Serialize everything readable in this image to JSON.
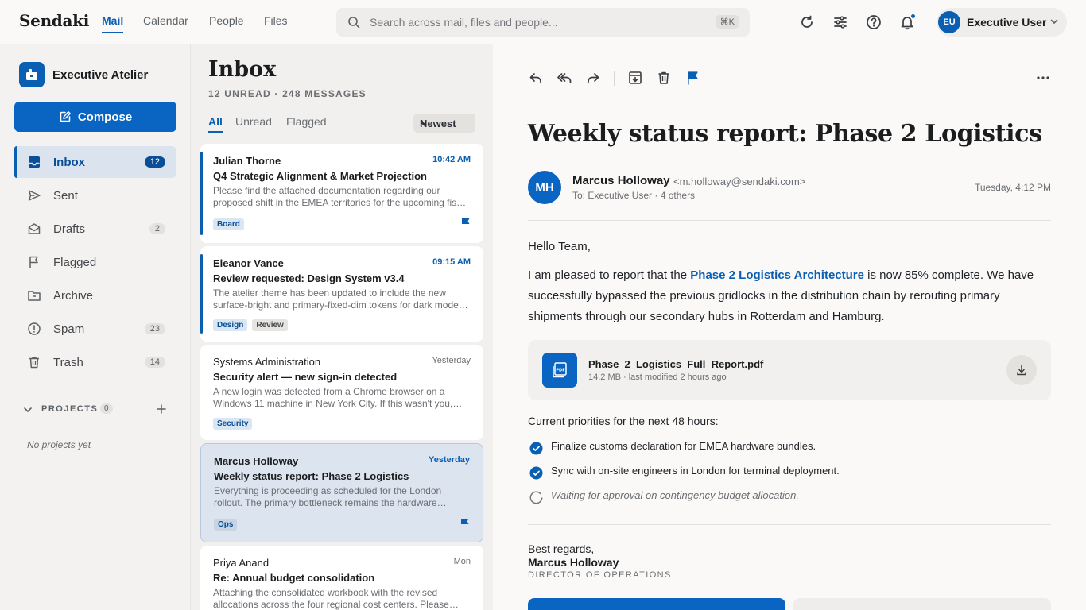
{
  "app": {
    "brand": "Sendaki"
  },
  "nav": {
    "tabs": [
      {
        "label": "Mail"
      },
      {
        "label": "Calendar"
      },
      {
        "label": "People"
      },
      {
        "label": "Files"
      }
    ]
  },
  "search": {
    "placeholder": "Search across mail, files and people...",
    "shortcut": "⌘K"
  },
  "user": {
    "initials": "EU",
    "name": "Executive User"
  },
  "sidebar": {
    "workspace": "Executive Atelier",
    "compose_label": "Compose",
    "items": [
      {
        "label": "Inbox",
        "count": "12"
      },
      {
        "label": "Sent",
        "count": ""
      },
      {
        "label": "Drafts",
        "count": "2"
      },
      {
        "label": "Flagged",
        "count": ""
      },
      {
        "label": "Archive",
        "count": ""
      },
      {
        "label": "Spam",
        "count": "23"
      },
      {
        "label": "Trash",
        "count": "14"
      }
    ],
    "projects": {
      "label": "PROJECTS",
      "count": "0",
      "empty": "No projects yet"
    }
  },
  "list": {
    "title": "Inbox",
    "summary": "12 UNREAD · 248 MESSAGES",
    "filters": [
      {
        "label": "All"
      },
      {
        "label": "Unread"
      },
      {
        "label": "Flagged"
      }
    ],
    "sort_label": "Newest",
    "messages": [
      {
        "sender": "Julian Thorne",
        "time": "10:42 AM",
        "subject": "Q4 Strategic Alignment & Market Projection",
        "preview": "Please find the attached documentation regarding our proposed shift in the EMEA territories for the upcoming fiscal quarter.",
        "tags": [
          "Board"
        ]
      },
      {
        "sender": "Eleanor Vance",
        "time": "09:15 AM",
        "subject": "Review requested: Design System v3.4",
        "preview": "The atelier theme has been updated to include the new surface-bright and primary-fixed-dim tokens for dark mode parity.",
        "tags": [
          "Design",
          "Review"
        ]
      },
      {
        "sender": "Systems Administration",
        "time": "Yesterday",
        "subject": "Security alert — new sign-in detected",
        "preview": "A new login was detected from a Chrome browser on a Windows 11 machine in New York City. If this wasn't you, secure your account.",
        "tags": [
          "Security"
        ]
      },
      {
        "sender": "Marcus Holloway",
        "time": "Yesterday",
        "subject": "Weekly status report: Phase 2 Logistics",
        "preview": "Everything is proceeding as scheduled for the London rollout. The primary bottleneck remains the hardware shipment.",
        "tags": [
          "Ops"
        ]
      },
      {
        "sender": "Priya Anand",
        "time": "Mon",
        "subject": "Re: Annual budget consolidation",
        "preview": "Attaching the consolidated workbook with the revised allocations across the four regional cost centers. Please review.",
        "tags": []
      }
    ]
  },
  "reader": {
    "subject": "Weekly status report: Phase 2 Logistics",
    "sender_initials": "MH",
    "sender_name": "Marcus Holloway",
    "sender_email": "<m.holloway@sendaki.com>",
    "recipients": "To: Executive User · 4 others",
    "date": "Tuesday, 4:12 PM",
    "greeting": "Hello Team,",
    "para_before_link": "I am pleased to report that the ",
    "para_link": "Phase 2 Logistics Architecture",
    "para_after_link": " is now 85% complete. We have successfully bypassed the previous gridlocks in the distribution chain by rerouting primary shipments through our secondary hubs in Rotterdam and Hamburg.",
    "attachment": {
      "name": "Phase_2_Logistics_Full_Report.pdf",
      "meta": "14.2 MB · last modified 2 hours ago"
    },
    "priorities_title": "Current priorities for the next 48 hours:",
    "priorities": [
      {
        "text": "Finalize customs declaration for EMEA hardware bundles.",
        "status": "done"
      },
      {
        "text": "Sync with on-site engineers in London for terminal deployment.",
        "status": "done"
      },
      {
        "text": "Waiting for approval on contingency budget allocation.",
        "status": "pending"
      }
    ],
    "signoff": "Best regards,",
    "signature_name": "Marcus Holloway",
    "signature_title": "DIRECTOR OF OPERATIONS"
  },
  "colors": {
    "accent": "#0a5fb3",
    "selected_bg": "#dce4ef",
    "background": "#faf9f8"
  },
  "icons": [
    "search-icon",
    "refresh-icon",
    "filters-icon",
    "help-icon",
    "bell-icon",
    "chevron-down-icon",
    "inbox-icon",
    "send-icon",
    "drafts-icon",
    "flag-icon",
    "archive-icon",
    "spam-icon",
    "trash-icon",
    "plus-icon",
    "reply-icon",
    "reply-all-icon",
    "forward-icon",
    "more-icon",
    "pdf-icon",
    "download-icon",
    "check-circle-icon",
    "pending-circle-icon"
  ]
}
